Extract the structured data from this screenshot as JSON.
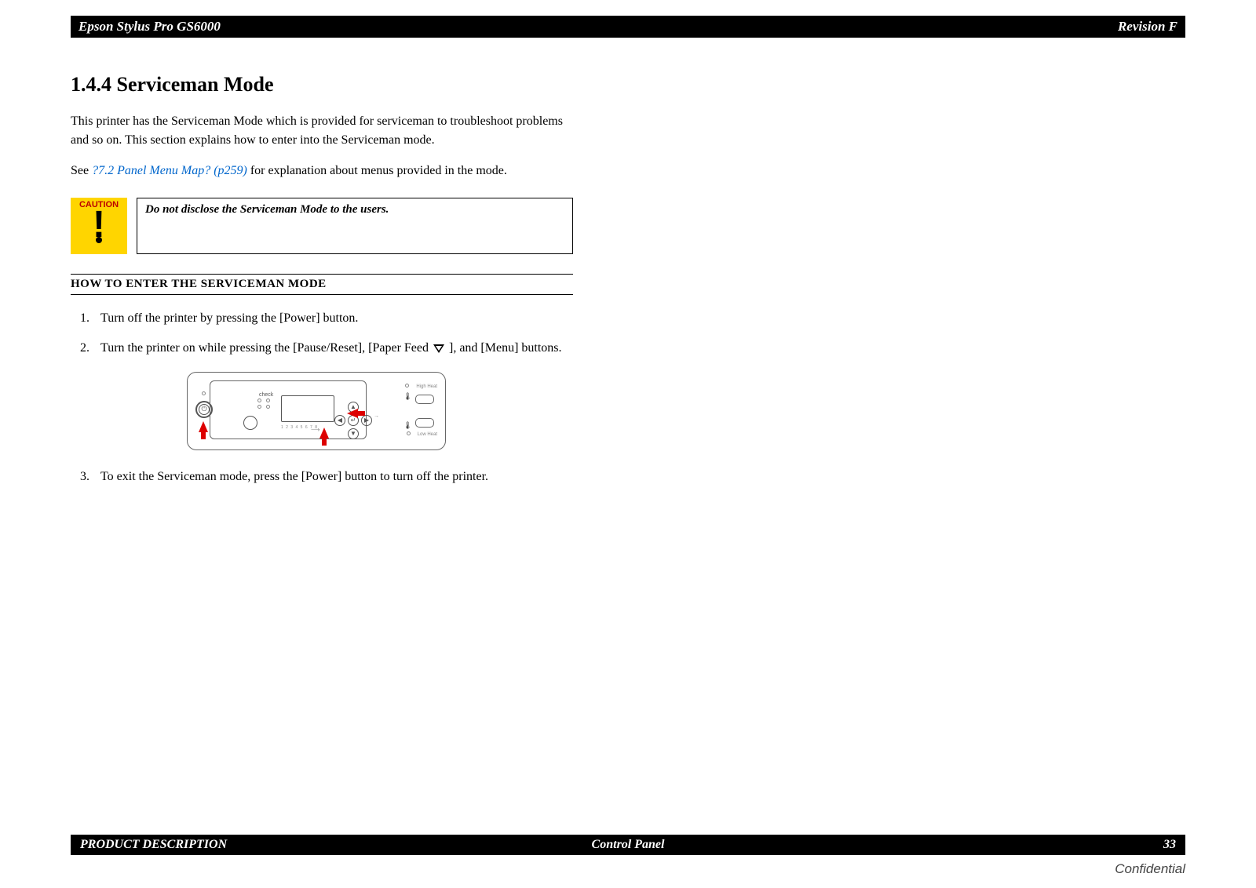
{
  "header": {
    "left": "Epson Stylus Pro GS6000",
    "right": "Revision F"
  },
  "section": {
    "number_title": "1.4.4  Serviceman Mode",
    "intro": "This printer has the Serviceman Mode which is provided for serviceman to troubleshoot problems and so on. This section explains how to enter into the Serviceman mode.",
    "see_prefix": "See ",
    "see_link": "?7.2 Panel Menu Map? (p259)",
    "see_suffix": " for explanation about menus provided in the mode."
  },
  "caution": {
    "label": "CAUTION",
    "text": "Do not disclose the Serviceman Mode to the users."
  },
  "subheading": "HOW TO ENTER THE SERVICEMAN MODE",
  "steps": {
    "s1": "Turn off the printer by pressing the [Power] button.",
    "s2a": "Turn the printer on while pressing the [Pause/Reset], [Paper Feed ",
    "s2b": " ], and [Menu] buttons.",
    "s3": "To exit the Serviceman mode, press the [Power] button to turn off the printer."
  },
  "panel": {
    "check": "check",
    "ink": "",
    "high_heat": "High Heat",
    "low_heat": "Low Heat",
    "pause": ""
  },
  "footer": {
    "left": "PRODUCT DESCRIPTION",
    "center": "Control Panel",
    "right": "33"
  },
  "confidential": "Confidential"
}
